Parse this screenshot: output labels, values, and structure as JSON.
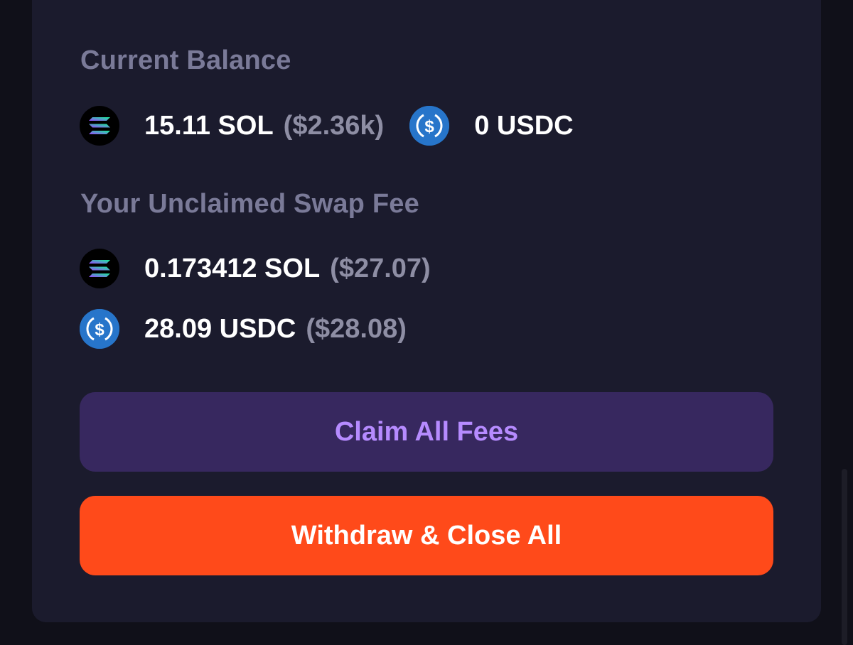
{
  "current_balance": {
    "title": "Current Balance",
    "sol": {
      "icon": "solana-icon",
      "amount": "15.11 SOL",
      "usd": "($2.36k)"
    },
    "usdc": {
      "icon": "usdc-icon",
      "amount": "0 USDC"
    }
  },
  "unclaimed_fee": {
    "title": "Your Unclaimed Swap Fee",
    "sol": {
      "icon": "solana-icon",
      "amount": "0.173412 SOL",
      "usd": "($27.07)"
    },
    "usdc": {
      "icon": "usdc-icon",
      "amount": "28.09 USDC",
      "usd": "($28.08)"
    }
  },
  "buttons": {
    "claim_label": "Claim All Fees",
    "withdraw_label": "Withdraw & Close All"
  },
  "colors": {
    "background": "#101019",
    "card": "#1b1b2d",
    "claim_button_bg": "#37285f",
    "claim_button_text": "#b68bff",
    "withdraw_button_bg": "#ff4a1a",
    "usdc_blue": "#2775ca"
  }
}
